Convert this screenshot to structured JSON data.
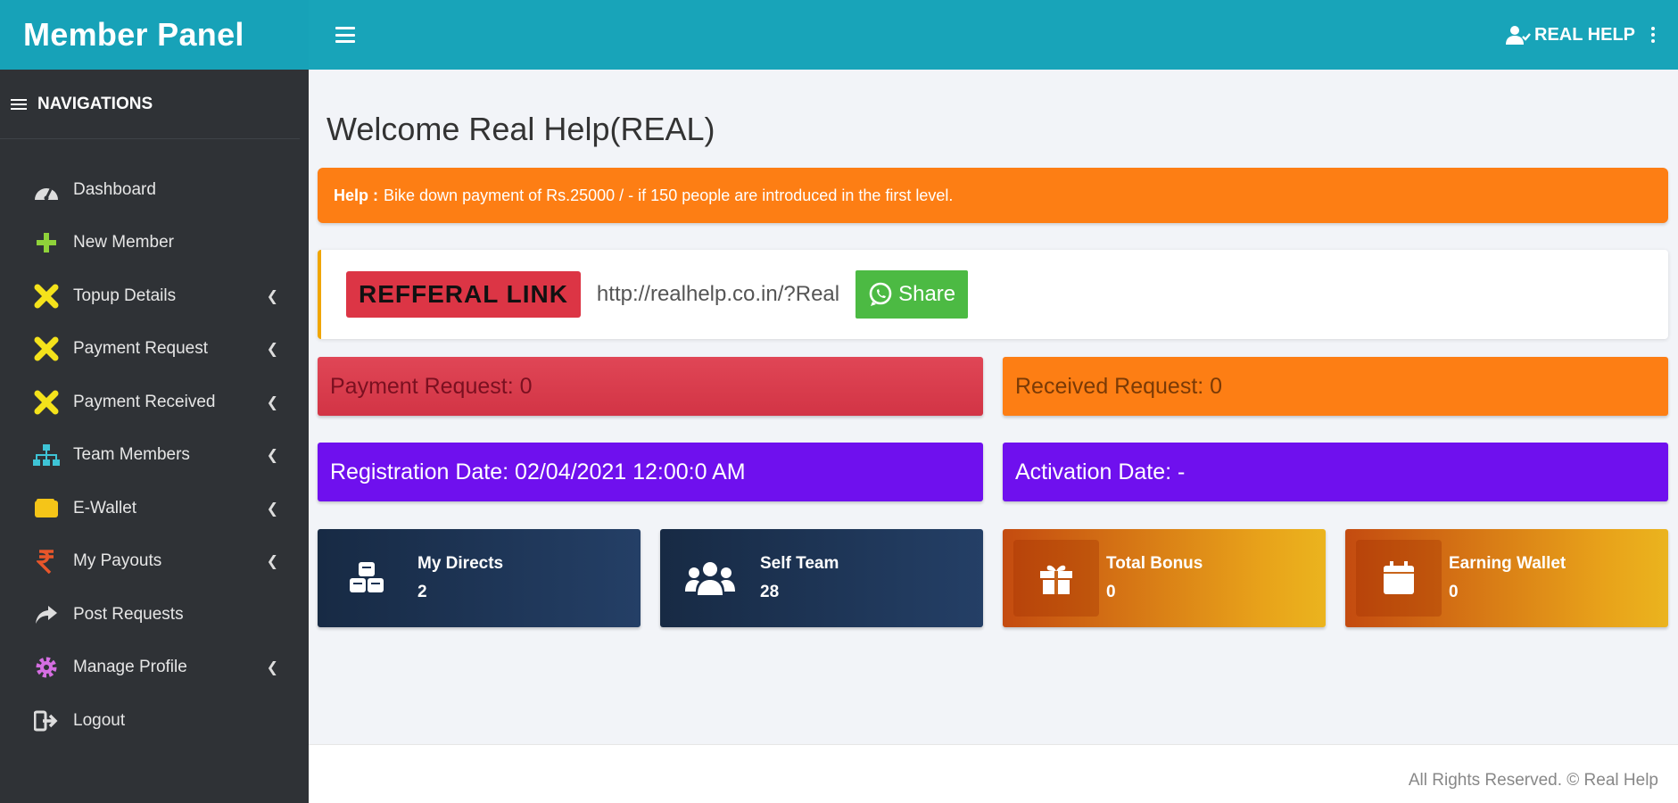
{
  "brand": {
    "title": "Member Panel"
  },
  "topbar": {
    "user_name": "REAL HELP"
  },
  "sidebar": {
    "header": "NAVIGATIONS",
    "items": [
      {
        "label": "Dashboard",
        "icon": "dashboard-icon",
        "has_submenu": false
      },
      {
        "label": "New Member",
        "icon": "plus-icon",
        "has_submenu": false
      },
      {
        "label": "Topup Details",
        "icon": "cross-icon",
        "has_submenu": true
      },
      {
        "label": "Payment Request",
        "icon": "cross-icon",
        "has_submenu": true
      },
      {
        "label": "Payment Received",
        "icon": "cross-icon",
        "has_submenu": true
      },
      {
        "label": "Team Members",
        "icon": "sitemap-icon",
        "has_submenu": true
      },
      {
        "label": "E-Wallet",
        "icon": "wallet-icon",
        "has_submenu": true
      },
      {
        "label": "My Payouts",
        "icon": "rupee-icon",
        "has_submenu": true
      },
      {
        "label": "Post Requests",
        "icon": "share-arrow-icon",
        "has_submenu": false
      },
      {
        "label": "Manage Profile",
        "icon": "gear-icon",
        "has_submenu": true
      },
      {
        "label": "Logout",
        "icon": "logout-icon",
        "has_submenu": false
      }
    ]
  },
  "main": {
    "welcome": "Welcome Real Help(REAL)",
    "help": {
      "label": "Help :",
      "text": "Bike down payment of Rs.25000 / - if 150 people are introduced in the first level."
    },
    "referral": {
      "label": "REFFERAL LINK",
      "url": "http://realhelp.co.in/?Real",
      "share_label": "Share"
    },
    "info_boxes": {
      "payment_request": "Payment Request: 0",
      "received_request": "Received Request: 0",
      "registration_date": "Registration Date: 02/04/2021 12:00:0 AM",
      "activation_date": "Activation Date: -"
    },
    "stats": [
      {
        "title": "My Directs",
        "value": "2",
        "icon": "cubes-icon"
      },
      {
        "title": "Self Team",
        "value": "28",
        "icon": "users-icon"
      },
      {
        "title": "Total Bonus",
        "value": "0",
        "icon": "gift-icon"
      },
      {
        "title": "Earning Wallet",
        "value": "0",
        "icon": "calendar-icon"
      }
    ]
  },
  "footer": {
    "text": "All Rights Reserved. © Real Help"
  },
  "colors": {
    "topbar": "#17a2b8",
    "sidebar": "#2f3236",
    "help": "#fd7e14",
    "referral_label": "#dc3545",
    "share": "#4cba43",
    "purple": "#6f10ee"
  }
}
